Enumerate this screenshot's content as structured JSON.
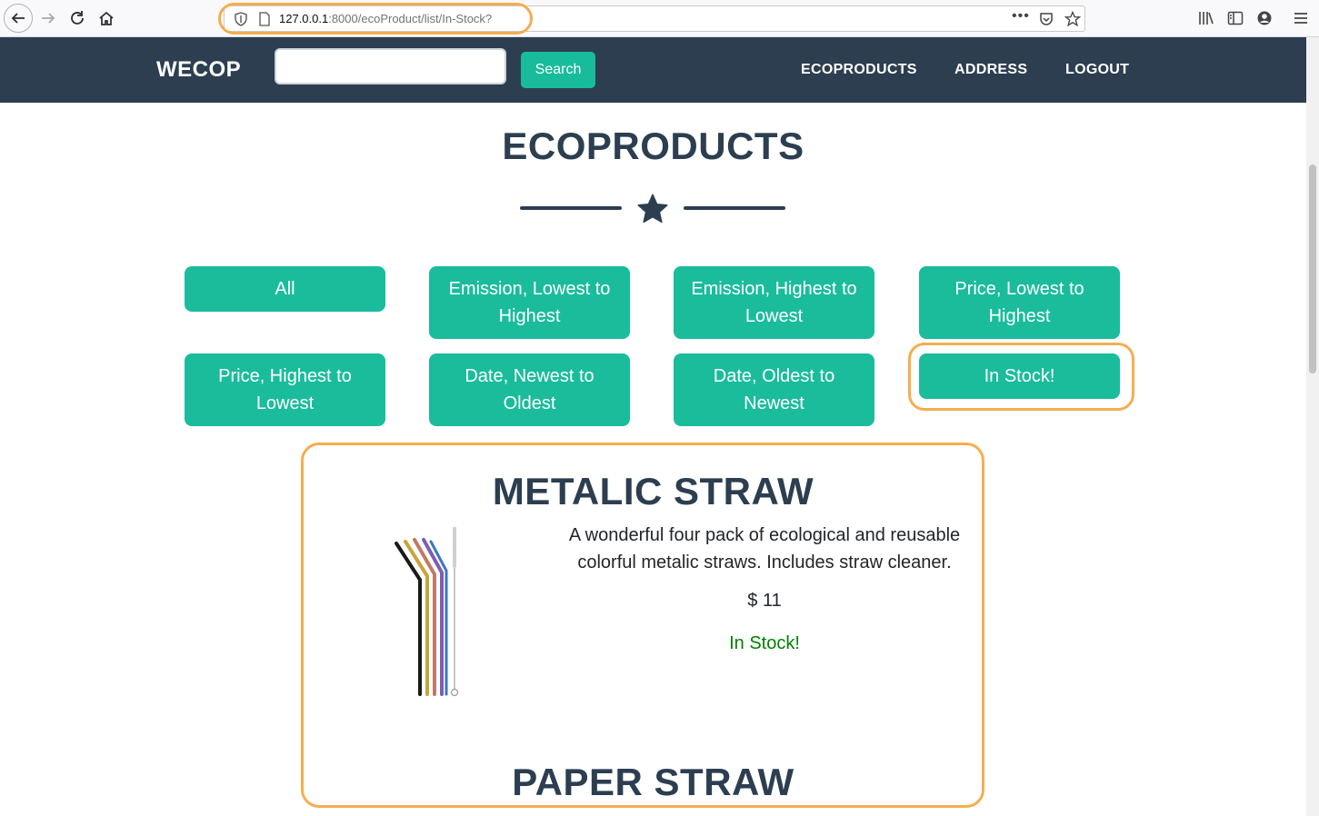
{
  "browser": {
    "url_host": "127.0.0.1",
    "url_rest": ":8000/ecoProduct/list/In-Stock?",
    "more_label": "•••"
  },
  "navbar": {
    "brand": "WECOP",
    "search_value": "",
    "search_button": "Search",
    "links": [
      "ECOPRODUCTS",
      "ADDRESS",
      "LOGOUT"
    ]
  },
  "page": {
    "title": "ECOPRODUCTS"
  },
  "filters": [
    "All",
    "Emission, Lowest to Highest",
    "Emission, Highest to Lowest",
    "Price, Lowest to Highest",
    "Price, Highest to Lowest",
    "Date, Newest to Oldest",
    "Date, Oldest to Newest",
    "In Stock!"
  ],
  "products": [
    {
      "name": "METALIC STRAW",
      "description": "A wonderful four pack of ecological and reusable colorful metalic straws. Includes straw cleaner.",
      "price": "$ 11",
      "stock": "In Stock!"
    },
    {
      "name": "PAPER STRAW"
    }
  ],
  "colors": {
    "navbar": "#2c3e50",
    "accent": "#18bc9c",
    "in_stock": "#008000",
    "highlight": "#f6ad4f"
  }
}
